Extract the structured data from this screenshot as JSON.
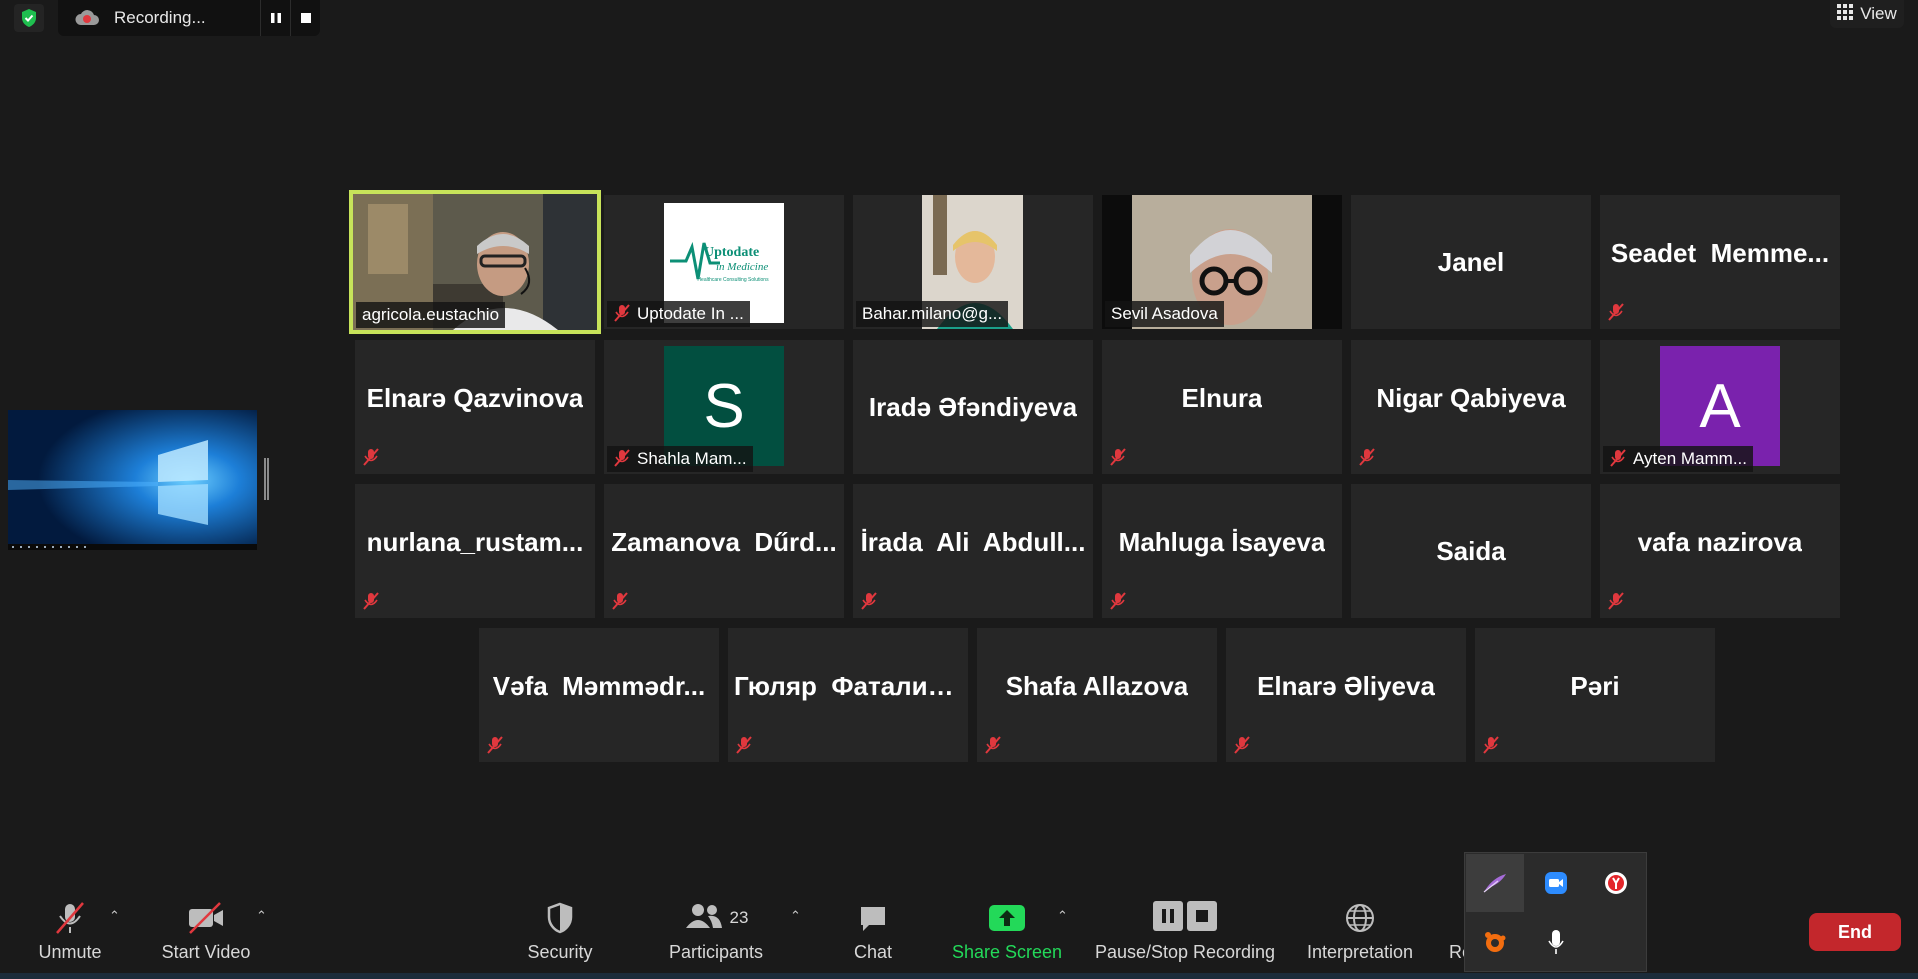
{
  "recording": {
    "status_text": "Recording..."
  },
  "view_button": {
    "label": "View"
  },
  "tiles": [
    {
      "name": "agricola.eustachio"
    },
    {
      "name": "Uptodate In ...",
      "logo_line1": "Uptodate",
      "logo_line2": "in Medicine",
      "logo_line3": "Healthcare Consulting Solutions"
    },
    {
      "name": "Bahar.milano@g..."
    },
    {
      "name": "Sevil Asadova"
    },
    {
      "name": "Janel"
    },
    {
      "name": "Seadet  Memme..."
    },
    {
      "name": "Elnarə Qazvinova"
    },
    {
      "name": "Shahla Mam...",
      "avatar_letter": "S",
      "avatar_color": "#024f40"
    },
    {
      "name": "Iradə Əfəndiyeva"
    },
    {
      "name": "Elnura"
    },
    {
      "name": "Nigar Qabiyeva"
    },
    {
      "name": "Ayten Mamm...",
      "avatar_letter": "A",
      "avatar_color": "#7a22ad"
    },
    {
      "name": "nurlana_rustam..."
    },
    {
      "name": "Zamanova  Dűrd..."
    },
    {
      "name": "İrada  Ali  Abdull..."
    },
    {
      "name": "Mahluga İsayeva"
    },
    {
      "name": "Saida"
    },
    {
      "name": "vafa nazirova"
    },
    {
      "name": "Vəfa  Məmmədr..."
    },
    {
      "name": "Гюляр  Фаталие..."
    },
    {
      "name": "Shafa Allazova"
    },
    {
      "name": "Elnarə Əliyeva"
    },
    {
      "name": "Pəri"
    }
  ],
  "toolbar": {
    "unmute": "Unmute",
    "start_video": "Start Video",
    "security": "Security",
    "participants": "Participants",
    "participants_count": "23",
    "chat": "Chat",
    "share_screen": "Share Screen",
    "pause_stop": "Pause/Stop Recording",
    "interpretation": "Interpretation",
    "reactions_partial": "Re",
    "end": "End"
  },
  "colors": {
    "active_speaker_border": "#c7e35a",
    "end_button": "#c3272c",
    "share_green": "#23d959",
    "mute_red": "#e0383e"
  },
  "tray_icons": [
    "feather-app-icon",
    "zoom-icon",
    "yandex-browser-icon",
    "avast-icon",
    "microphone-icon"
  ]
}
